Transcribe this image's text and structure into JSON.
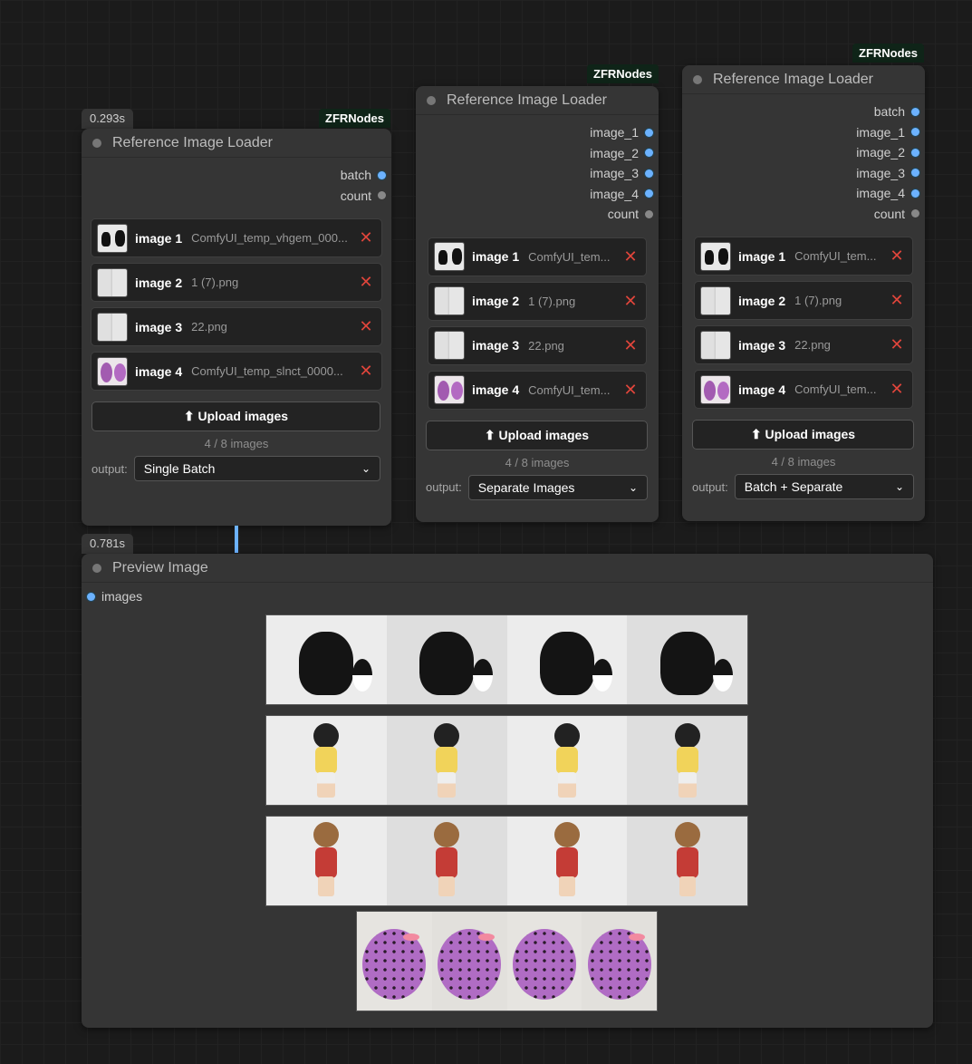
{
  "nodes": [
    {
      "timing": "0.293s",
      "tag": "ZFRNodes",
      "title": "Reference Image Loader",
      "outputs": [
        {
          "label": "batch",
          "color": "blue"
        },
        {
          "label": "count",
          "color": "grey"
        }
      ],
      "images": [
        {
          "label": "image 1",
          "file": "ComfyUI_temp_vhgem_000...",
          "thumb": "cat"
        },
        {
          "label": "image 2",
          "file": "1 (7).png",
          "thumb": "blank"
        },
        {
          "label": "image 3",
          "file": "22.png",
          "thumb": "blank"
        },
        {
          "label": "image 4",
          "file": "ComfyUI_temp_slnct_0000...",
          "thumb": "duck"
        }
      ],
      "upload_label": "⬆ Upload images",
      "count_text": "4 / 8 images",
      "output_label": "output:",
      "output_value": "Single Batch"
    },
    {
      "tag": "ZFRNodes",
      "title": "Reference Image Loader",
      "outputs": [
        {
          "label": "image_1",
          "color": "blue"
        },
        {
          "label": "image_2",
          "color": "blue"
        },
        {
          "label": "image_3",
          "color": "blue"
        },
        {
          "label": "image_4",
          "color": "blue"
        },
        {
          "label": "count",
          "color": "grey"
        }
      ],
      "images": [
        {
          "label": "image 1",
          "file": "ComfyUI_tem...",
          "thumb": "cat"
        },
        {
          "label": "image 2",
          "file": "1 (7).png",
          "thumb": "blank"
        },
        {
          "label": "image 3",
          "file": "22.png",
          "thumb": "blank"
        },
        {
          "label": "image 4",
          "file": "ComfyUI_tem...",
          "thumb": "duck"
        }
      ],
      "upload_label": "⬆ Upload images",
      "count_text": "4 / 8 images",
      "output_label": "output:",
      "output_value": "Separate Images"
    },
    {
      "tag": "ZFRNodes",
      "title": "Reference Image Loader",
      "outputs": [
        {
          "label": "batch",
          "color": "blue"
        },
        {
          "label": "image_1",
          "color": "blue"
        },
        {
          "label": "image_2",
          "color": "blue"
        },
        {
          "label": "image_3",
          "color": "blue"
        },
        {
          "label": "image_4",
          "color": "blue"
        },
        {
          "label": "count",
          "color": "grey"
        }
      ],
      "images": [
        {
          "label": "image 1",
          "file": "ComfyUI_tem...",
          "thumb": "cat"
        },
        {
          "label": "image 2",
          "file": "1 (7).png",
          "thumb": "blank"
        },
        {
          "label": "image 3",
          "file": "22.png",
          "thumb": "blank"
        },
        {
          "label": "image 4",
          "file": "ComfyUI_tem...",
          "thumb": "duck"
        }
      ],
      "upload_label": "⬆ Upload images",
      "count_text": "4 / 8 images",
      "output_label": "output:",
      "output_value": "Batch + Separate"
    }
  ],
  "preview": {
    "timing": "0.781s",
    "title": "Preview Image",
    "input_label": "images",
    "rows": [
      {
        "subject": "cat",
        "frames": 4
      },
      {
        "subject": "boy",
        "frames": 4
      },
      {
        "subject": "girl",
        "frames": 4
      },
      {
        "subject": "duck",
        "frames": 4
      }
    ]
  },
  "colors": {
    "port_blue": "#6cb2ff",
    "remove_red": "#e0453b",
    "tag_bg": "#0f2418",
    "node_bg": "#353535"
  },
  "icons": {
    "remove": "✕",
    "chevron": "⌄"
  }
}
